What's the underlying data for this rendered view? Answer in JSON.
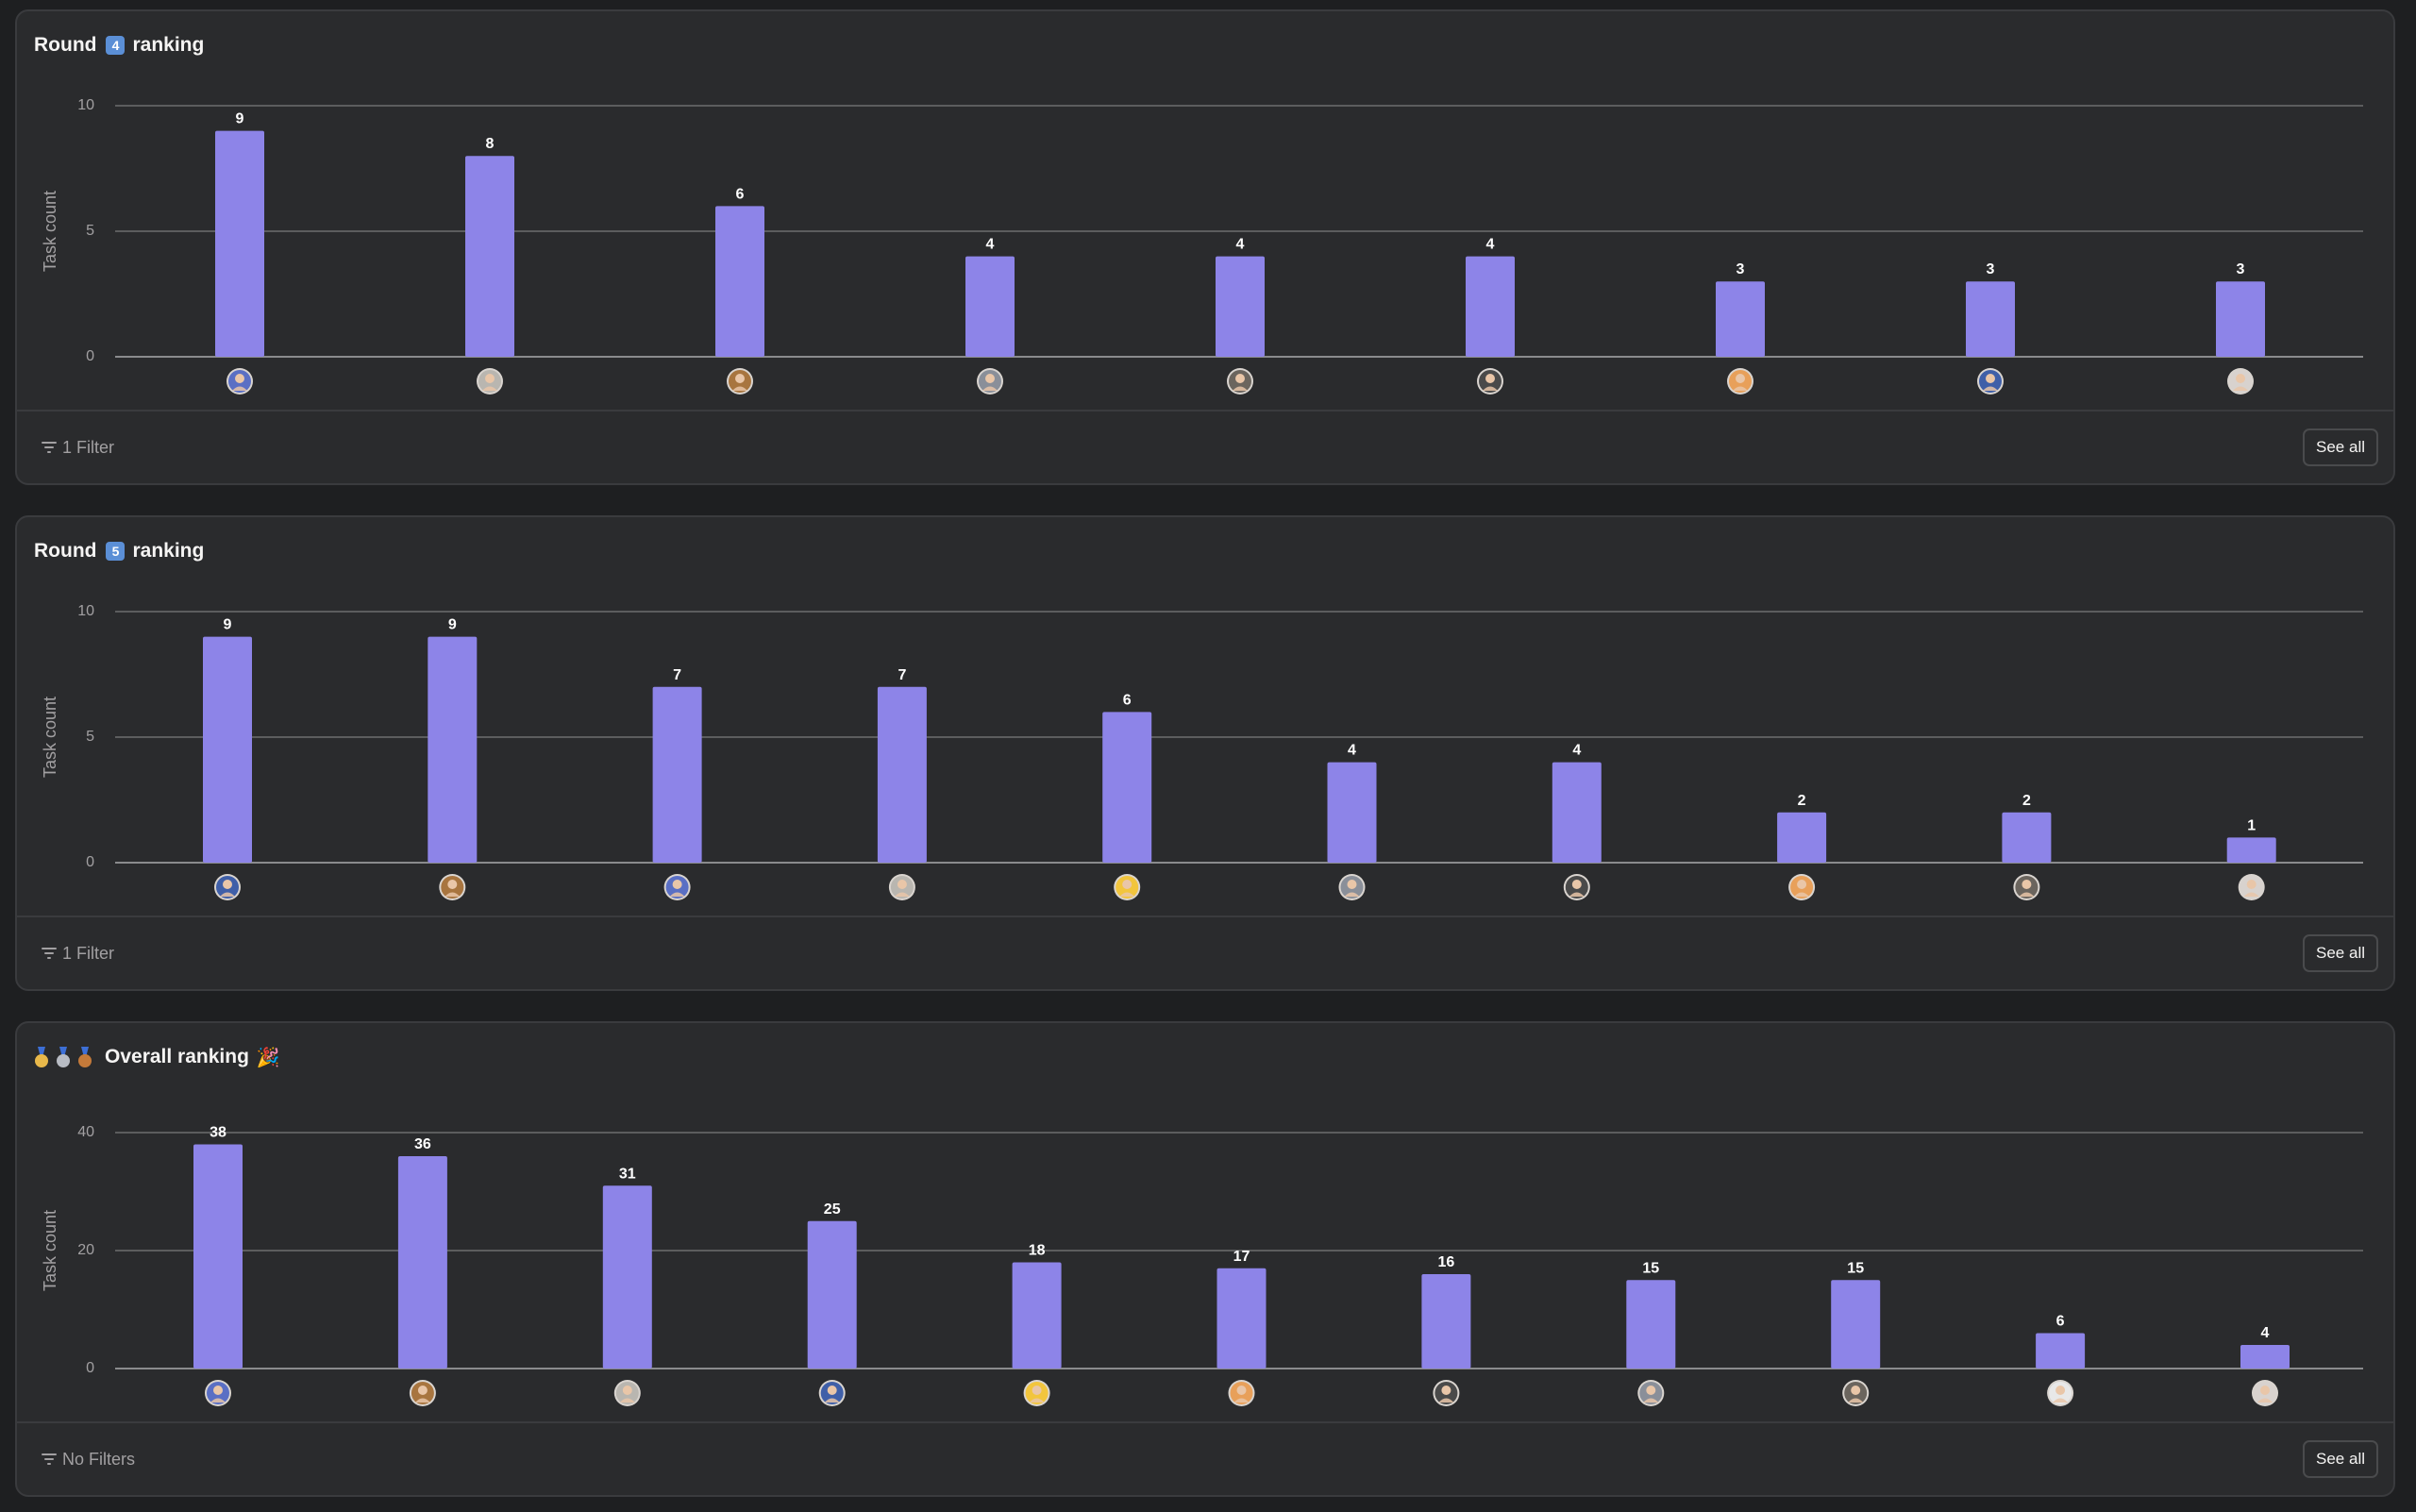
{
  "cards": [
    {
      "title_pre": "Round",
      "title_badge": "4",
      "title_post": "ranking",
      "filter_label": "1 Filter",
      "see_all_label": "See all"
    },
    {
      "title_pre": "Round",
      "title_badge": "5",
      "title_post": "ranking",
      "filter_label": "1 Filter",
      "see_all_label": "See all"
    },
    {
      "title_text": "Overall ranking",
      "filter_label": "No Filters",
      "see_all_label": "See all"
    }
  ],
  "colors": {
    "bar": "#8d84e8",
    "grid": "#6d6e6f",
    "axis_text": "#a2a0a2",
    "background": "#2a2b2d"
  },
  "chart_data": [
    {
      "type": "bar",
      "ylabel": "Task count",
      "ylim": [
        0,
        10
      ],
      "yticks": [
        0,
        5,
        10
      ],
      "values": [
        9,
        8,
        6,
        4,
        4,
        4,
        3,
        3,
        3
      ],
      "data_labels": [
        "9",
        "8",
        "6",
        "4",
        "4",
        "4",
        "3",
        "3",
        "3"
      ],
      "categories_avatars": [
        "avatar-woman-blue",
        "avatar-man-gray",
        "avatar-woman-brown",
        "avatar-man-suit",
        "avatar-man-dark",
        "avatar-headphones",
        "avatar-orange",
        "avatar-man-blue",
        "avatar-woman-light"
      ],
      "grid": true
    },
    {
      "type": "bar",
      "ylabel": "Task count",
      "ylim": [
        0,
        10
      ],
      "yticks": [
        0,
        5,
        10
      ],
      "values": [
        9,
        9,
        7,
        7,
        6,
        4,
        4,
        2,
        2,
        1
      ],
      "data_labels": [
        "9",
        "9",
        "7",
        "7",
        "6",
        "4",
        "4",
        "2",
        "2",
        "1"
      ],
      "categories_avatars": [
        "avatar-man-blue",
        "avatar-woman-brown",
        "avatar-woman-blue",
        "avatar-man-gray",
        "avatar-yellow",
        "avatar-man-suit",
        "avatar-headphones",
        "avatar-orange",
        "avatar-man-dark",
        "avatar-woman-light"
      ],
      "grid": true
    },
    {
      "type": "bar",
      "ylabel": "Task count",
      "ylim": [
        0,
        40
      ],
      "yticks": [
        0,
        20,
        40
      ],
      "values": [
        38,
        36,
        31,
        25,
        18,
        17,
        16,
        15,
        15,
        6,
        4
      ],
      "data_labels": [
        "38",
        "36",
        "31",
        "25",
        "18",
        "17",
        "16",
        "15",
        "15",
        "6",
        "4"
      ],
      "categories_avatars": [
        "avatar-woman-blue",
        "avatar-woman-brown",
        "avatar-man-gray",
        "avatar-man-blue",
        "avatar-yellow",
        "avatar-orange",
        "avatar-headphones",
        "avatar-man-suit",
        "avatar-man-dark",
        "avatar-man-white",
        "avatar-woman-light"
      ],
      "grid": true
    }
  ],
  "avatar_colors": {
    "avatar-woman-blue": "#5a6fc4",
    "avatar-man-gray": "#b9b6b0",
    "avatar-woman-brown": "#a8753f",
    "avatar-man-suit": "#8a8f99",
    "avatar-man-dark": "#6b655e",
    "avatar-headphones": "#4a4a4a",
    "avatar-orange": "#e8a05a",
    "avatar-man-blue": "#3f5fa8",
    "avatar-woman-light": "#d8d2ce",
    "avatar-yellow": "#f2c53d",
    "avatar-man-white": "#e8e8e8"
  },
  "medal_colors": [
    "#e8b84a",
    "#b8bcc4",
    "#c47a3a"
  ]
}
